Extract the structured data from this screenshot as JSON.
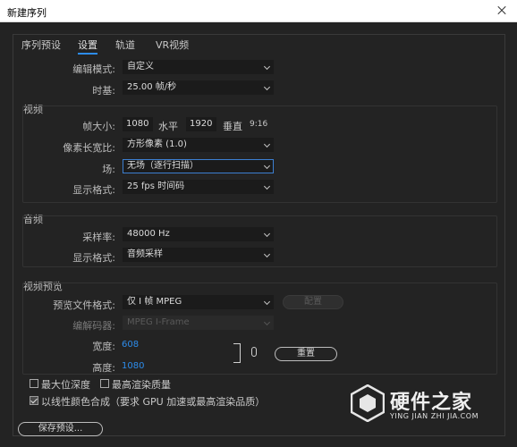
{
  "window": {
    "title": "新建序列"
  },
  "tabs": [
    "序列预设",
    "设置",
    "轨道",
    "VR视频"
  ],
  "settings": {
    "edit_mode_label": "编辑模式:",
    "edit_mode_value": "自定义",
    "timebase_label": "时基:",
    "timebase_value": "25.00 帧/秒"
  },
  "video": {
    "title": "视频",
    "frame_size_label": "帧大小:",
    "frame_width": "1080",
    "horizontal_label": "水平",
    "frame_height": "1920",
    "vertical_label": "垂直",
    "aspect": "9:16",
    "pixel_aspect_label": "像素长宽比:",
    "pixel_aspect_value": "方形像素 (1.0)",
    "field_label": "场:",
    "field_value": "无场（逐行扫描）",
    "display_format_label": "显示格式:",
    "display_format_value": "25 fps 时间码"
  },
  "audio": {
    "title": "音频",
    "sample_rate_label": "采样率:",
    "sample_rate_value": "48000 Hz",
    "display_format_label": "显示格式:",
    "display_format_value": "音频采样"
  },
  "preview": {
    "title": "视频预览",
    "file_format_label": "预览文件格式:",
    "file_format_value": "仅 I 帧 MPEG",
    "configure_label": "配置",
    "codec_label": "编解码器:",
    "codec_value": "MPEG I-Frame",
    "width_label": "宽度:",
    "width_value": "608",
    "height_label": "高度:",
    "height_value": "1080",
    "reset_label": "重置"
  },
  "options": {
    "max_bit_depth": "最大位深度",
    "max_render_quality": "最高渲染质量",
    "linear_color": "以线性颜色合成（要求 GPU 加速或最高渲染品质）"
  },
  "footer": {
    "save_preset_label": "保存预设..."
  },
  "watermark": {
    "name": "硬件之家",
    "url": "YING JIAN ZHI JIA.COM"
  },
  "colors": {
    "accent": "#2d8ceb",
    "background": "#232323",
    "field": "#1b1b1b"
  }
}
